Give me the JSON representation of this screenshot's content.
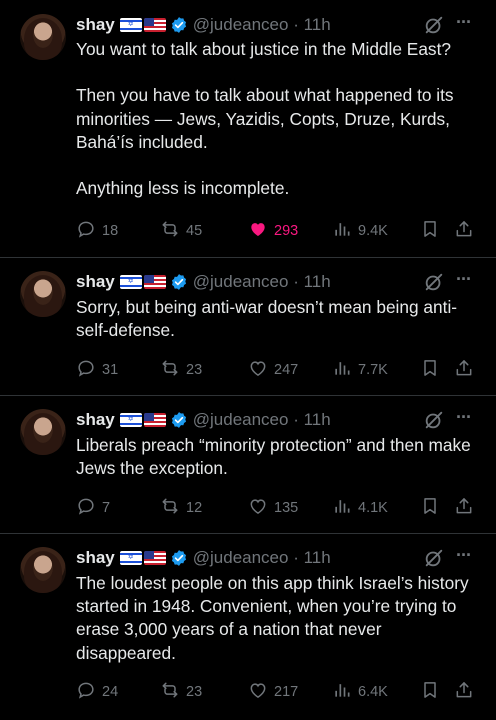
{
  "tweets": [
    {
      "name": "shay",
      "handle": "@judeanceo · 11h",
      "text": "You want to talk about justice in the Middle East?\n\nThen you have to talk about what happened to its minorities — Jews, Yazidis, Copts, Druze, Kurds, Bahá’ís included.\n\nAnything less is incomplete.",
      "replies": "18",
      "reposts": "45",
      "likes": "293",
      "views": "9.4K",
      "liked": true
    },
    {
      "name": "shay",
      "handle": "@judeanceo · 11h",
      "text": "Sorry, but being anti-war doesn’t mean being anti-self-defense.",
      "replies": "31",
      "reposts": "23",
      "likes": "247",
      "views": "7.7K",
      "liked": false
    },
    {
      "name": "shay",
      "handle": "@judeanceo · 11h",
      "text": "Liberals preach “minority protection” and then make Jews the exception.",
      "replies": "7",
      "reposts": "12",
      "likes": "135",
      "views": "4.1K",
      "liked": false
    },
    {
      "name": "shay",
      "handle": "@judeanceo · 11h",
      "text": "The loudest people on this app think Israel’s history started in 1948. Convenient, when you’re trying to erase 3,000 years of a nation that never disappeared.",
      "replies": "24",
      "reposts": "23",
      "likes": "217",
      "views": "6.4K",
      "liked": false
    }
  ],
  "colors": {
    "like_active": "#f91880",
    "verified": "#1d9bf0",
    "muted": "#71767b",
    "text": "#e7e9ea",
    "divider": "#2f3336"
  },
  "icons": [
    "verified-badge-icon",
    "grok-icon",
    "more-icon",
    "reply-icon",
    "repost-icon",
    "like-icon",
    "views-icon",
    "bookmark-icon",
    "share-icon"
  ]
}
